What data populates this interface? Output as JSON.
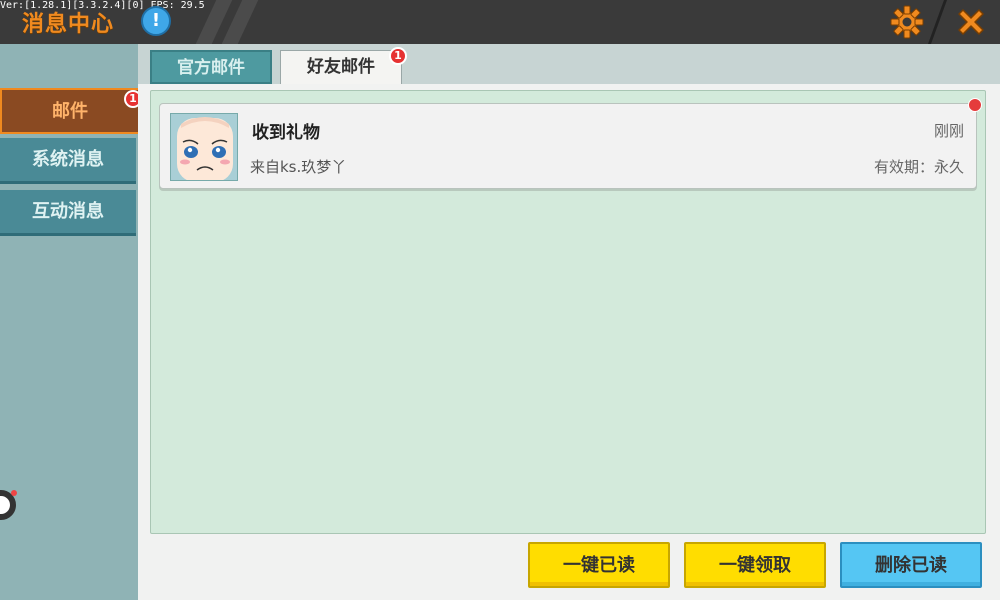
{
  "header": {
    "debug_text": "Ver:[1.28.1][3.3.2.4][0] FPS: 29.5",
    "title": "消息中心",
    "info_glyph": "!",
    "icons": {
      "info": "info-icon",
      "settings": "gear-icon",
      "close": "close-icon"
    },
    "accent_color": "#f08a1f"
  },
  "sidebar": {
    "items": [
      {
        "label": "邮件",
        "active": true,
        "badge": "1"
      },
      {
        "label": "系统消息",
        "active": false
      },
      {
        "label": "互动消息",
        "active": false
      }
    ]
  },
  "tabs": [
    {
      "label": "官方邮件",
      "active": false
    },
    {
      "label": "好友邮件",
      "active": true,
      "badge": "1"
    }
  ],
  "mail_list": [
    {
      "title": "收到礼物",
      "from": "来自ks.玖梦丫",
      "time": "刚刚",
      "validity": "有效期：永久",
      "unread": true,
      "avatar_icon": "avatar-face-icon"
    }
  ],
  "actions": {
    "mark_all_read": "一键已读",
    "claim_all": "一键领取",
    "delete_read": "删除已读"
  },
  "colors": {
    "panel_bg": "#d3eadb",
    "badge_red": "#e63232",
    "button_yellow": "#ffdd00",
    "button_blue": "#55c6f3"
  }
}
